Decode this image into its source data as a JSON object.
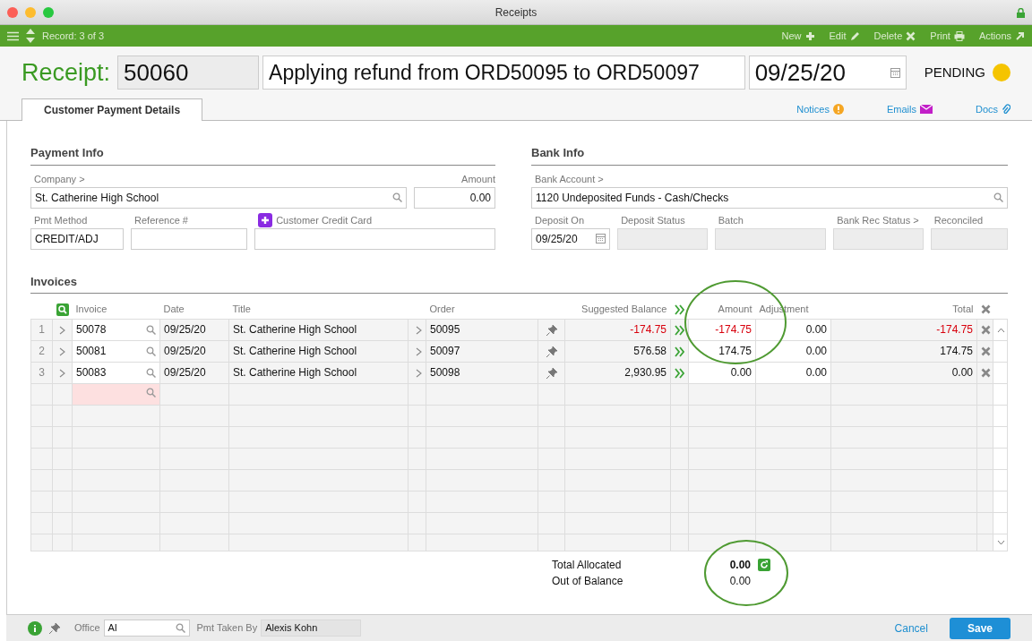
{
  "window": {
    "title": "Receipts"
  },
  "toolbar": {
    "record": "Record: 3 of 3",
    "actions": [
      {
        "label": "New",
        "kind": "plus"
      },
      {
        "label": "Edit",
        "kind": "pencil"
      },
      {
        "label": "Delete",
        "kind": "cross"
      },
      {
        "label": "Print",
        "kind": "printer"
      },
      {
        "label": "Actions",
        "kind": "arrow"
      }
    ]
  },
  "header": {
    "label": "Receipt:",
    "number": "50060",
    "title": "Applying refund from ORD50095 to ORD50097",
    "date": "09/25/20",
    "status": "PENDING"
  },
  "tabs": [
    {
      "label": "Customer Payment Details",
      "selected": true
    }
  ],
  "links": [
    {
      "label": "Notices",
      "kind": "alert"
    },
    {
      "label": "Emails",
      "kind": "mail"
    },
    {
      "label": "Docs",
      "kind": "clip"
    }
  ],
  "payment_info": {
    "heading": "Payment Info",
    "rows": [
      [
        {
          "label": "Company >",
          "value": "St. Catherine High School",
          "readonly": false
        },
        {
          "label": "Amount",
          "value": "0.00",
          "readonly": false
        }
      ],
      [
        {
          "label": "Pmt Method",
          "value": "CREDIT/ADJ",
          "readonly": false
        },
        {
          "label": "Reference #",
          "readonly": false
        },
        {
          "label": "Customer Credit Card",
          "readonly": false
        }
      ]
    ]
  },
  "bank_info": {
    "heading": "Bank Info",
    "rows": [
      [
        {
          "label": "Bank Account >",
          "value": "1120 Undeposited Funds - Cash/Checks",
          "readonly": false
        }
      ],
      [
        {
          "label": "Deposit On",
          "value": "09/25/20",
          "readonly": false
        },
        {
          "label": "Deposit Status",
          "readonly": true
        },
        {
          "label": "Batch",
          "readonly": true
        },
        {
          "label": "Bank Rec Status >",
          "readonly": true
        },
        {
          "label": "Reconciled",
          "readonly": true
        }
      ]
    ]
  },
  "invoices": {
    "heading": "Invoices",
    "columns": [
      "Invoice",
      "Date",
      "Title",
      "Order",
      "Suggested Balance",
      "Amount",
      "Adjustment",
      "Total"
    ],
    "rows": [
      {
        "index": "1",
        "invoice": "50078",
        "date": "09/25/20",
        "title": "St. Catherine High School",
        "order": "50095",
        "suggested": "-174.75",
        "amount": "-174.75",
        "adjustment": "0.00",
        "total": "-174.75",
        "negative": true
      },
      {
        "index": "2",
        "invoice": "50081",
        "date": "09/25/20",
        "title": "St. Catherine High School",
        "order": "50097",
        "suggested": "576.58",
        "amount": "174.75",
        "adjustment": "0.00",
        "total": "174.75",
        "negative": false
      },
      {
        "index": "3",
        "invoice": "50083",
        "date": "09/25/20",
        "title": "St. Catherine High School",
        "order": "50098",
        "suggested": "2,930.95",
        "amount": "0.00",
        "adjustment": "0.00",
        "total": "0.00",
        "negative": false
      }
    ]
  },
  "totals": [
    {
      "label": "Total Allocated",
      "value": "0.00",
      "bold": true
    },
    {
      "label": "Out of Balance",
      "value": "0.00",
      "bold": false
    }
  ],
  "footer": {
    "office_label": "Office",
    "office": "AI",
    "taken_label": "Pmt Taken By",
    "taken": "Alexis Kohn",
    "cancel": "Cancel",
    "save": "Save"
  }
}
